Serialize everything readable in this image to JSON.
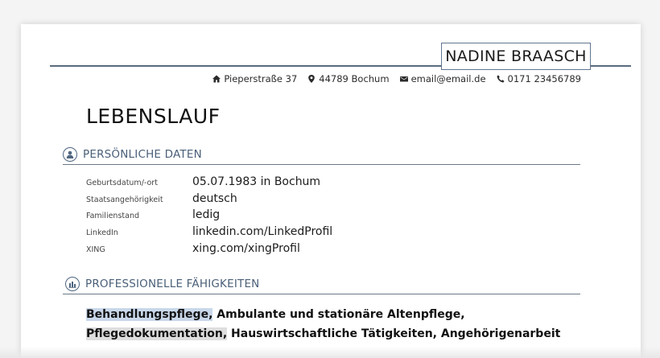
{
  "header": {
    "name": "NADINE BRAASCH",
    "contact": [
      {
        "icon": "home-icon",
        "text": "Pieperstraße 37"
      },
      {
        "icon": "location-pin-icon",
        "text": "44789 Bochum"
      },
      {
        "icon": "mail-icon",
        "text": "email@email.de"
      },
      {
        "icon": "phone-icon",
        "text": "0171 23456789"
      }
    ]
  },
  "title": "LEBENSLAUF",
  "personal": {
    "heading": "PERSÖNLICHE DATEN",
    "icon": "person-icon",
    "rows": [
      {
        "label": "Geburtsdatum/-ort",
        "value": "05.07.1983 in Bochum"
      },
      {
        "label": "Staatsangehörigkeit",
        "value": "deutsch"
      },
      {
        "label": "Familienstand",
        "value": "ledig"
      },
      {
        "label": "LinkedIn",
        "value": "linkedin.com/LinkedProfil"
      },
      {
        "label": "XING",
        "value": "xing.com/xingProfil"
      }
    ]
  },
  "skills": {
    "heading": "PROFESSIONELLE FÄHIGKEITEN",
    "icon": "skills-icon",
    "items": [
      "Behandlungspflege,",
      "Ambulante und stationäre Altenpflege,",
      "Pflegedokumentation,",
      "Hauswirtschaftliche Tätigkeiten,",
      "Angehörigenarbeit"
    ],
    "highlight_colors": {
      "blue": "#c9d8ea",
      "grey": "#dedede"
    }
  },
  "colors": {
    "accent": "#4a5f78",
    "rule": "#5a6b7d"
  }
}
